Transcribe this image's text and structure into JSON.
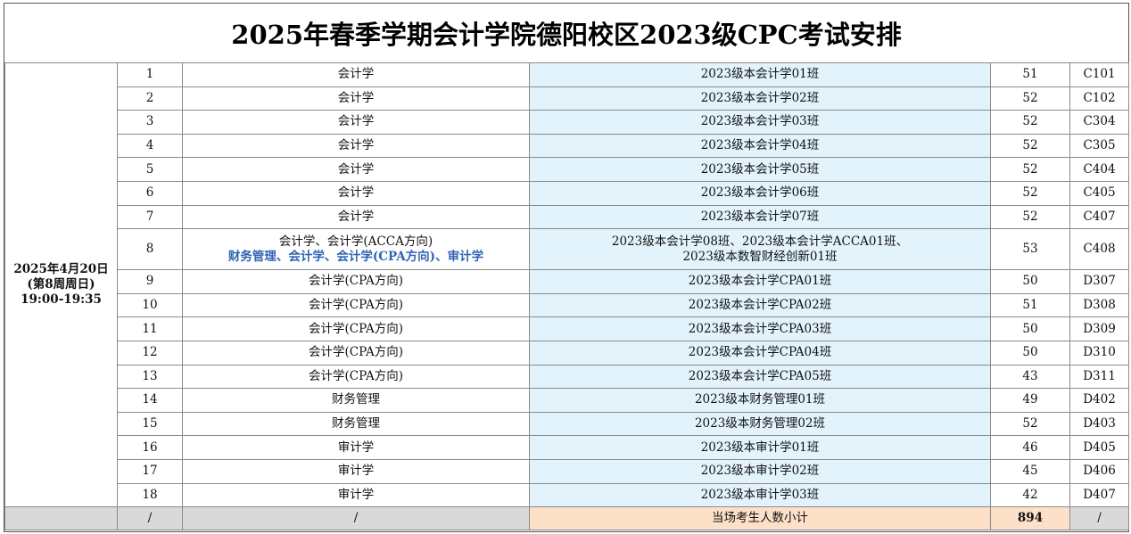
{
  "title": "2025年春季学期会计学院德阳校区2023级CPC考试安排",
  "exam_time": {
    "date": "2025年4月20日",
    "week": "(第8周周日)",
    "time": "19:00-19:35"
  },
  "rows": [
    {
      "no": "1",
      "major": "会计学",
      "major2": "",
      "class_name": "2023级本会计学01班",
      "class_name2": "",
      "count": "51",
      "room": "C101"
    },
    {
      "no": "2",
      "major": "会计学",
      "major2": "",
      "class_name": "2023级本会计学02班",
      "class_name2": "",
      "count": "52",
      "room": "C102"
    },
    {
      "no": "3",
      "major": "会计学",
      "major2": "",
      "class_name": "2023级本会计学03班",
      "class_name2": "",
      "count": "52",
      "room": "C304"
    },
    {
      "no": "4",
      "major": "会计学",
      "major2": "",
      "class_name": "2023级本会计学04班",
      "class_name2": "",
      "count": "52",
      "room": "C305"
    },
    {
      "no": "5",
      "major": "会计学",
      "major2": "",
      "class_name": "2023级本会计学05班",
      "class_name2": "",
      "count": "52",
      "room": "C404"
    },
    {
      "no": "6",
      "major": "会计学",
      "major2": "",
      "class_name": "2023级本会计学06班",
      "class_name2": "",
      "count": "52",
      "room": "C405"
    },
    {
      "no": "7",
      "major": "会计学",
      "major2": "",
      "class_name": "2023级本会计学07班",
      "class_name2": "",
      "count": "52",
      "room": "C407"
    },
    {
      "no": "8",
      "major": "会计学、会计学(ACCA方向)",
      "major2": "财务管理、会计学、会计学(CPA方向)、审计学",
      "class_name": "2023级本会计学08班、2023级本会计学ACCA01班、",
      "class_name2": "2023级本数智财经创新01班",
      "count": "53",
      "room": "C408"
    },
    {
      "no": "9",
      "major": "会计学(CPA方向)",
      "major2": "",
      "class_name": "2023级本会计学CPA01班",
      "class_name2": "",
      "count": "50",
      "room": "D307"
    },
    {
      "no": "10",
      "major": "会计学(CPA方向)",
      "major2": "",
      "class_name": "2023级本会计学CPA02班",
      "class_name2": "",
      "count": "51",
      "room": "D308"
    },
    {
      "no": "11",
      "major": "会计学(CPA方向)",
      "major2": "",
      "class_name": "2023级本会计学CPA03班",
      "class_name2": "",
      "count": "50",
      "room": "D309"
    },
    {
      "no": "12",
      "major": "会计学(CPA方向)",
      "major2": "",
      "class_name": "2023级本会计学CPA04班",
      "class_name2": "",
      "count": "50",
      "room": "D310"
    },
    {
      "no": "13",
      "major": "会计学(CPA方向)",
      "major2": "",
      "class_name": "2023级本会计学CPA05班",
      "class_name2": "",
      "count": "43",
      "room": "D311"
    },
    {
      "no": "14",
      "major": "财务管理",
      "major2": "",
      "class_name": "2023级本财务管理01班",
      "class_name2": "",
      "count": "49",
      "room": "D402"
    },
    {
      "no": "15",
      "major": "财务管理",
      "major2": "",
      "class_name": "2023级本财务管理02班",
      "class_name2": "",
      "count": "52",
      "room": "D403"
    },
    {
      "no": "16",
      "major": "审计学",
      "major2": "",
      "class_name": "2023级本审计学01班",
      "class_name2": "",
      "count": "46",
      "room": "D405"
    },
    {
      "no": "17",
      "major": "审计学",
      "major2": "",
      "class_name": "2023级本审计学02班",
      "class_name2": "",
      "count": "45",
      "room": "D406"
    },
    {
      "no": "18",
      "major": "审计学",
      "major2": "",
      "class_name": "2023级本审计学03班",
      "class_name2": "",
      "count": "42",
      "room": "D407"
    }
  ],
  "total_row": {
    "no": "/",
    "major": "/",
    "label": "当场考生人数小计",
    "value": "894",
    "room": "/"
  },
  "colors": {
    "date_text": "#1f5f8f",
    "highlight_text": "#2f64b4",
    "class_column_bg": "#e3f3fb",
    "total_bg": "#d9d9d9",
    "total_label_bg": "#fde0c8"
  }
}
